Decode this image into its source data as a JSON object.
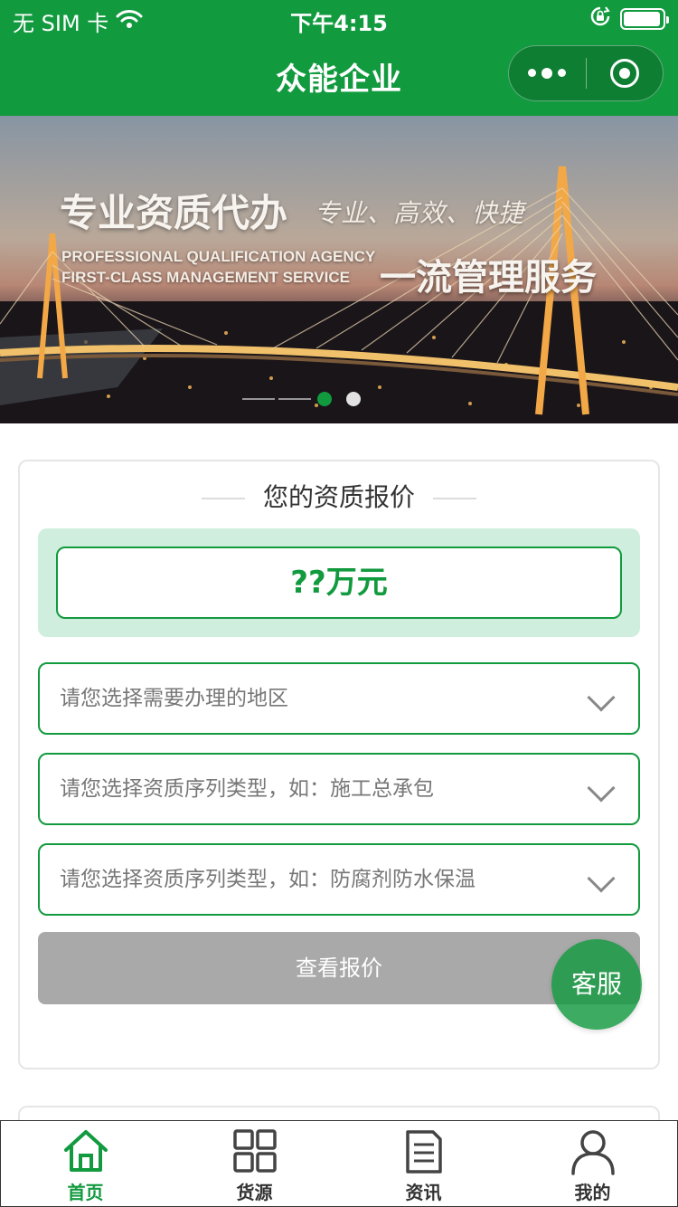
{
  "status_bar": {
    "carrier": "无 SIM 卡",
    "time": "下午4:15"
  },
  "nav": {
    "title": "众能企业",
    "more_icon": "more-dots-icon",
    "close_icon": "target-circle-icon"
  },
  "banner": {
    "headline": "专业资质代办",
    "tagline": "专业、高效、快捷",
    "english_line1": "PROFESSIONAL QUALIFICATION AGENCY",
    "english_line2": "FIRST-CLASS MANAGEMENT SERVICE",
    "slogan": "一流管理服务",
    "slide_count": 2,
    "active_slide": 1
  },
  "quote": {
    "title": "您的资质报价",
    "price": "??万元",
    "region_placeholder": "请您选择需要办理的地区",
    "category_placeholder": "请您选择资质序列类型，如：施工总承包",
    "type_placeholder": "请您选择资质序列类型，如：防腐剂防水保温",
    "submit_label": "查看报价"
  },
  "service_button": "客服",
  "tabs": [
    {
      "label": "首页",
      "icon": "home-icon",
      "active": true
    },
    {
      "label": "货源",
      "icon": "grid-icon",
      "active": false
    },
    {
      "label": "资讯",
      "icon": "document-icon",
      "active": false
    },
    {
      "label": "我的",
      "icon": "user-icon",
      "active": false
    }
  ],
  "colors": {
    "brand": "#129a3f",
    "price_panel": "#cfeedd",
    "button_disabled": "#a9a9a9"
  }
}
